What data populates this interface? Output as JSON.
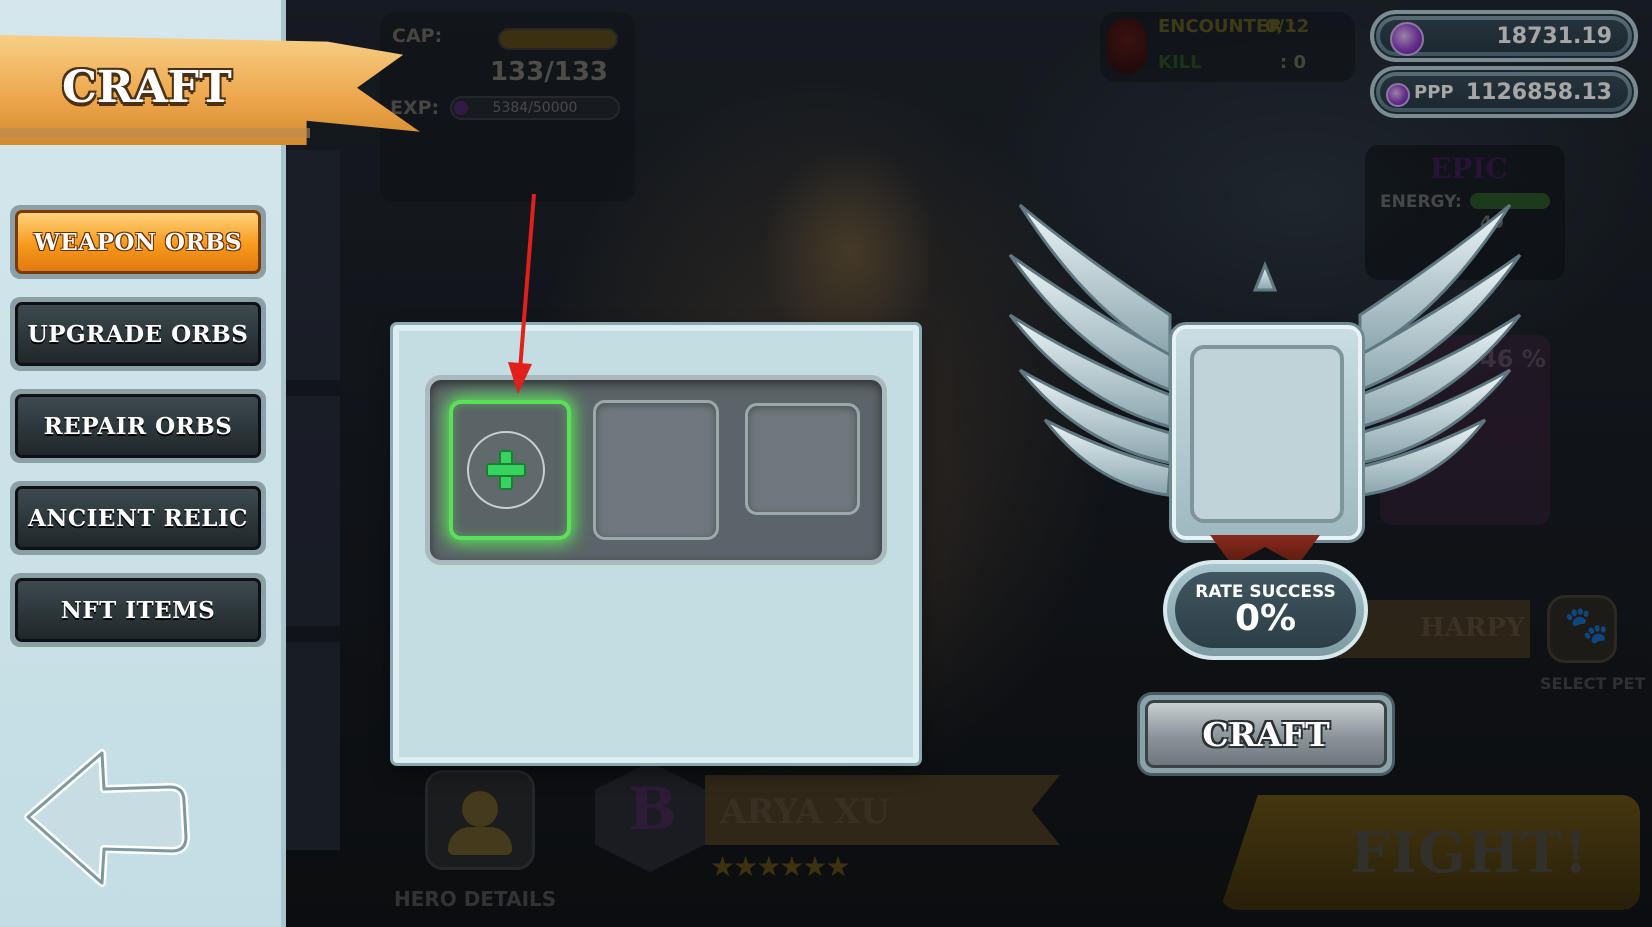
{
  "screen_title": "CRAFT",
  "menu": {
    "items": [
      {
        "label": "WEAPON ORBS",
        "active": true
      },
      {
        "label": "UPGRADE ORBS",
        "active": false
      },
      {
        "label": "REPAIR ORBS",
        "active": false
      },
      {
        "label": "ANCIENT RELIC",
        "active": false
      },
      {
        "label": "NFT ITEMS",
        "active": false
      }
    ]
  },
  "hero_stats": {
    "cap_label": "CAP:",
    "cap_value": "133/133",
    "exp_label": "EXP:",
    "exp_value": "5384/50000"
  },
  "encounter": {
    "encounter_label": "ENCOUNTER :",
    "encounter_value": "0/12",
    "kill_label": "KILL",
    "kill_value": ": 0"
  },
  "currency": {
    "gem_amount": "18731.19",
    "ppp_label": "PPP",
    "ppp_amount": "1126858.13"
  },
  "pet": {
    "rarity": "EPIC",
    "energy_label": "ENERGY:",
    "energy_value": "40",
    "success_percent": "46 %",
    "name": "HARPY",
    "select_label": "SELECT PET"
  },
  "craft_slots": {
    "count": 3,
    "active_index": 0
  },
  "result": {
    "rate_label": "RATE SUCCESS",
    "rate_value": "0%",
    "craft_button": "CRAFT"
  },
  "hero": {
    "rank": "B",
    "name": "ARYA XU",
    "stars": "★★★★★★",
    "details_label": "HERO DETAILS"
  },
  "fight_button": "FIGHT!",
  "colors": {
    "active_tab": "#f69a1c",
    "slot_highlight": "#5ce05a",
    "panel_bg": "#c3dde3",
    "annotation_arrow": "#e0201a"
  }
}
